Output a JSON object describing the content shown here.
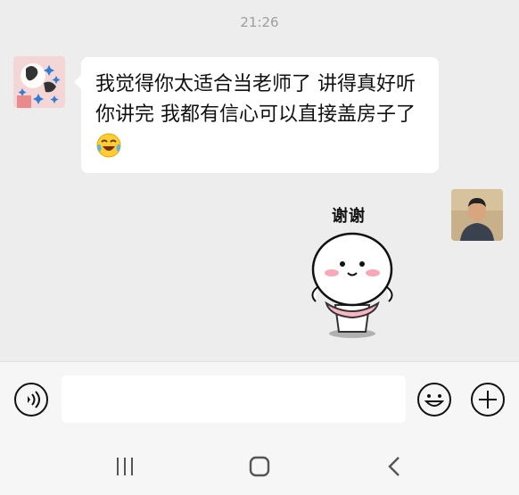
{
  "status": {
    "time": "21:26"
  },
  "messages": [
    {
      "side": "left",
      "avatar": "pattern-avatar",
      "text": "我觉得你太适合当老师了 讲得真好听你讲完 我都有信心可以直接盖房子了",
      "trailing_emoji": "laughing-tears-emoji"
    },
    {
      "side": "right",
      "avatar": "photo-avatar",
      "sticker": "thank-you-sticker",
      "sticker_text": "谢谢"
    }
  ],
  "composer": {
    "value": "",
    "placeholder": ""
  },
  "icons": {
    "voice": "voice-icon",
    "emoji": "emoji-face-icon",
    "plus": "plus-icon",
    "recent": "recent-apps-icon",
    "home": "home-icon",
    "back": "back-icon"
  },
  "colors": {
    "background": "#ededed",
    "bubble": "#ffffff",
    "bar": "#f6f6f6"
  }
}
